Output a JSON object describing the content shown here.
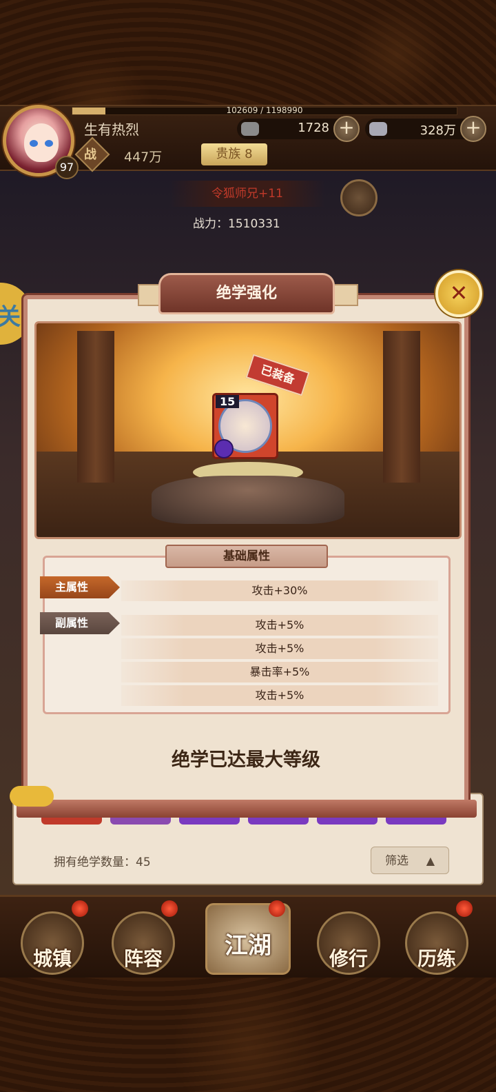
{
  "player": {
    "name": "生有热烈",
    "level": "97",
    "exp_text": "102609 / 1198990",
    "exp_progress": 0.0856,
    "power_label": "战",
    "power_value": "447万",
    "noble": "贵族 8"
  },
  "resources": [
    {
      "icon": "gold-ingot-icon",
      "value": "1728",
      "plus": "+"
    },
    {
      "icon": "silver-ingot-icon",
      "value": "328万",
      "plus": "+"
    }
  ],
  "opponent": {
    "name": "令狐师兄+11",
    "power": "战力：1510331"
  },
  "modal": {
    "title": "绝学强化",
    "close_symbol": "✕",
    "skill_level": "15",
    "equipped_tag": "已装备",
    "attr_section_title": "基础属性",
    "main_attr_label": "主属性",
    "sub_attr_label": "副属性",
    "main_attr": "攻击+30%",
    "sub_attrs": [
      "攻击+5%",
      "攻击+5%",
      "暴击率+5%",
      "攻击+5%"
    ],
    "max_level_text": "绝学已达最大等级"
  },
  "lower_panel": {
    "owned_count": "拥有绝学数量：45",
    "filter_label": "筛选",
    "filter_arrow": "▲"
  },
  "nav": {
    "items": [
      "城镇",
      "阵容",
      "江湖",
      "修行",
      "历练"
    ]
  },
  "side_button": "关",
  "colors": {
    "accent_gold": "#d6b06c",
    "modal_border": "#c28673",
    "equipped_red": "#c23b32",
    "opponent_red": "#c13a2a"
  }
}
